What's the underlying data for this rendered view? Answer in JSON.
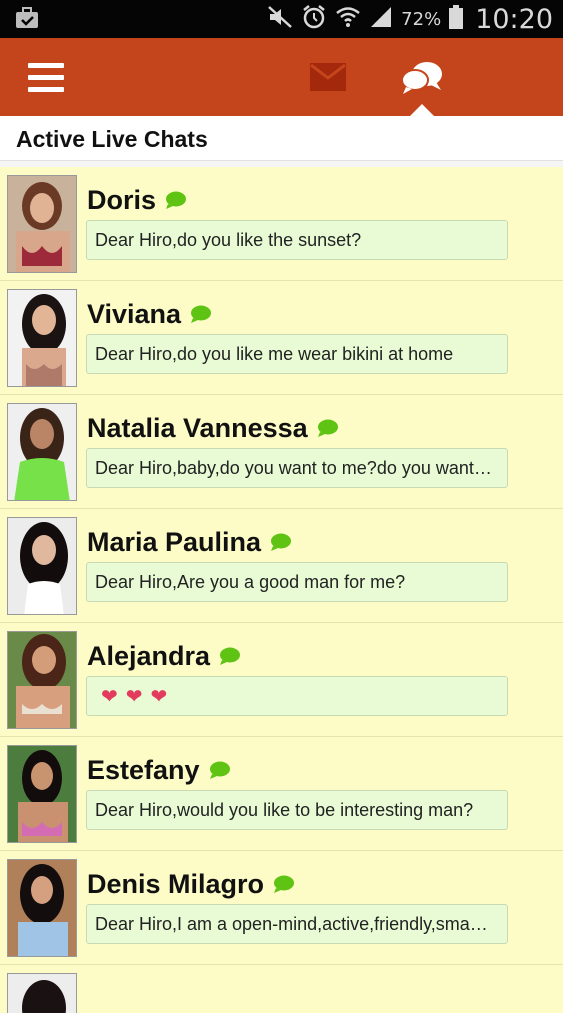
{
  "status_bar": {
    "battery_percent": "72%",
    "time": "10:20",
    "icons": [
      "briefcase-check-icon",
      "mute-icon",
      "alarm-icon",
      "wifi-icon",
      "signal-icon",
      "battery-icon"
    ]
  },
  "app_bar": {
    "icons": [
      "menu-icon",
      "mail-icon",
      "chat-bubbles-icon"
    ],
    "accent_color": "#c4441b"
  },
  "section": {
    "title": "Active Live Chats"
  },
  "chats": [
    {
      "name": "Doris",
      "message": "Dear Hiro,do you like the sunset?",
      "avatar_color": "#7a4a3a"
    },
    {
      "name": "Viviana",
      "message": "Dear Hiro,do you like me wear bikini at home",
      "avatar_color": "#3a2a2a"
    },
    {
      "name": "Natalia Vannessa",
      "message": "Dear Hiro,baby,do you want to me?do you want…",
      "avatar_color": "#6ccd4a"
    },
    {
      "name": "Maria Paulina",
      "message": "Dear Hiro,Are you a good man for me?",
      "avatar_color": "#2b2020"
    },
    {
      "name": "Alejandra",
      "message": "",
      "hearts": [
        "❤",
        "❤",
        "❤"
      ],
      "avatar_color": "#8c4e3a"
    },
    {
      "name": "Estefany",
      "message": "Dear Hiro,would you like to be interesting man?",
      "avatar_color": "#4c7a3a"
    },
    {
      "name": "Denis Milagro",
      "message": "Dear Hiro,I am a open-mind,active,friendly,sma…",
      "avatar_color": "#6a8fb0"
    }
  ]
}
